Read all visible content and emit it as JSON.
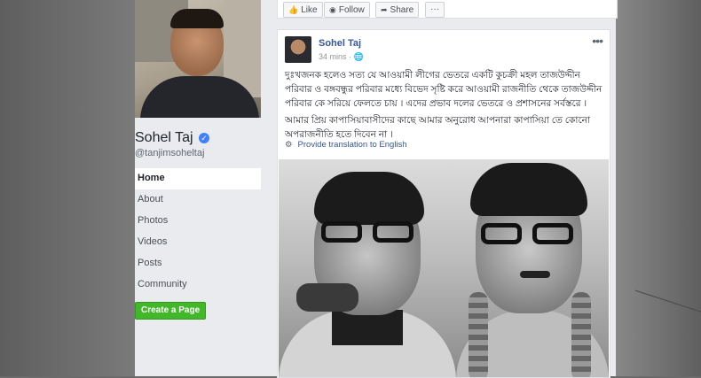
{
  "page": {
    "name": "Sohel Taj",
    "handle": "@tanjimsoheltaj"
  },
  "nav": {
    "items": [
      {
        "label": "Home",
        "active": true
      },
      {
        "label": "About"
      },
      {
        "label": "Photos"
      },
      {
        "label": "Videos"
      },
      {
        "label": "Posts"
      },
      {
        "label": "Community"
      }
    ],
    "create_page_label": "Create a Page"
  },
  "actions": {
    "like": "Like",
    "follow": "Follow",
    "share": "Share",
    "more": "···"
  },
  "post": {
    "author": "Sohel Taj",
    "time": "34 mins ·",
    "text_1": "দুঃখজনক হলেও সত্য যে আওয়ামী লীগের ভেতরে একটি কুচক্রী মহল তাজউদ্দীন পরিবার ও বঙ্গবন্ধুর পরিবার মধ্যে বিভেদ সৃষ্টি করে আওয়ামী রাজনীতি থেকে তাজউদ্দীন পরিবার কে সরিয়ে ফেলতে চায় । এদের প্রভাব দলের ভেতরে ও প্রশাসনের সর্বস্তরে ।",
    "text_2": "আমার প্রিয় কাপাসিয়াবাসীদের কাছে আমার অনুরোধ আপনারা কাপাসিয়া তে কোনো অপরাজনীতি হতে দিবেন না ।",
    "translate": "Provide translation to English"
  },
  "colors": {
    "link": "#365899",
    "create_button": "#42b72a",
    "verified": "#4080ff"
  }
}
